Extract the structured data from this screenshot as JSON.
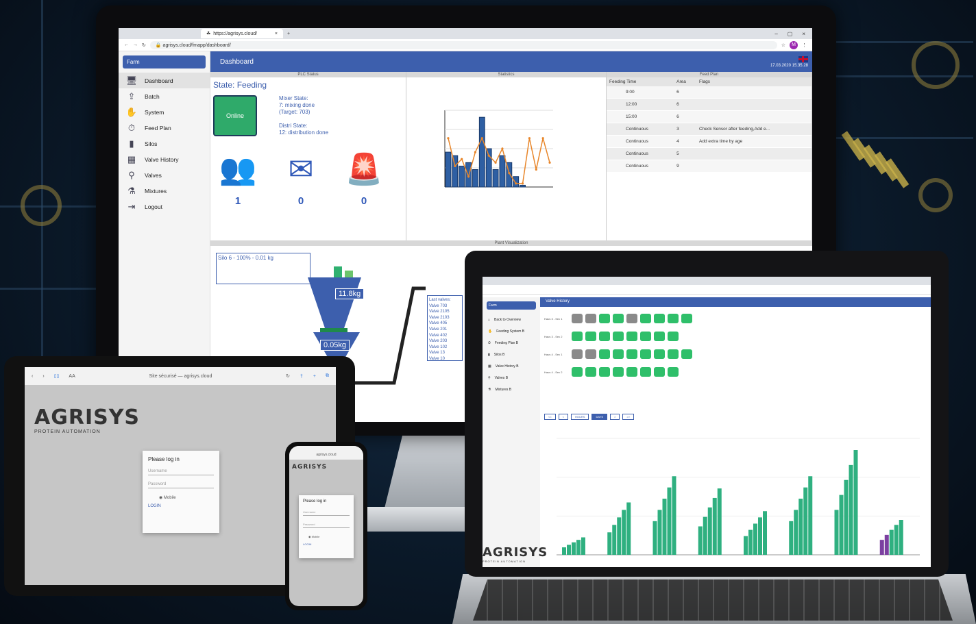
{
  "monitor": {
    "browser": {
      "tab_title": "https://agrisys.cloud/",
      "url": "agrisys.cloud/fmapp/dashboard/",
      "avatar_letter": "M"
    },
    "sidebar": {
      "farm_label": "Farm",
      "items": [
        {
          "label": "Dashboard",
          "icon": "monitor-icon"
        },
        {
          "label": "Batch",
          "icon": "batch-icon"
        },
        {
          "label": "System",
          "icon": "system-icon"
        },
        {
          "label": "Feed Plan",
          "icon": "feed-plan-icon"
        },
        {
          "label": "Silos",
          "icon": "silo-icon"
        },
        {
          "label": "Valve History",
          "icon": "valve-history-icon"
        },
        {
          "label": "Valves",
          "icon": "valve-icon"
        },
        {
          "label": "Mixtures",
          "icon": "mixture-icon"
        },
        {
          "label": "Logout",
          "icon": "logout-icon"
        }
      ]
    },
    "header": {
      "title": "Dashboard",
      "datetime": "17.03.2020 15.35.28"
    },
    "plc": {
      "panel_title": "PLC Status",
      "state": "State: Feeding",
      "online": "Online",
      "mixer_lines": [
        "Mixer State:",
        "7: mixing done",
        "(Target: 703)"
      ],
      "distri_lines": [
        "Distri State:",
        "12: distribution done"
      ],
      "counts": [
        {
          "icon": "users-icon",
          "value": "1"
        },
        {
          "icon": "mail-icon",
          "value": "0"
        },
        {
          "icon": "alarm-icon",
          "value": "0"
        }
      ]
    },
    "statistics": {
      "panel_title": "Statistics"
    },
    "feed_plan": {
      "panel_title": "Feed Plan",
      "columns": [
        "Feeding Time",
        "Area",
        "Flags"
      ],
      "rows": [
        [
          "9:00",
          "6",
          ""
        ],
        [
          "12:00",
          "6",
          ""
        ],
        [
          "15:00",
          "6",
          ""
        ],
        [
          "Continuous",
          "3",
          "Check Sensor after feeding,Add e..."
        ],
        [
          "Continuous",
          "4",
          "Add extra time by age"
        ],
        [
          "Continuous",
          "5",
          ""
        ],
        [
          "Continuous",
          "9",
          ""
        ]
      ]
    },
    "plant": {
      "panel_title": "Plant Visualization",
      "silo_label": "Silo 6 - 100% - 0.01 kg",
      "weight_top": "11.8kg",
      "weight_bottom": "0.05kg",
      "last_valves": [
        "Last valves:",
        "Valve 703",
        "Valve 2105",
        "Valve 2103",
        "Valve 405",
        "Valve 201",
        "Valve 402",
        "Valve 203",
        "Valve 102",
        "Valve 13",
        "Valve 10"
      ]
    }
  },
  "tablet": {
    "url": "Site sécurisé — agrisys.cloud",
    "logo": "AGRISYS",
    "logo_sub": "PROTEIN AUTOMATION",
    "login": {
      "title": "Please log in",
      "username": "Username",
      "password": "Password",
      "mobile": "Mobile",
      "button": "LOGIN"
    }
  },
  "phone": {
    "url": "agrisys.cloud",
    "login": {
      "title": "Please log in",
      "username": "Username",
      "password": "Password",
      "mobile": "Mobile",
      "button": "LOGIN"
    }
  },
  "laptop": {
    "header": {
      "title": "Valve History"
    },
    "sidebar": {
      "farm_label": "Farm",
      "items": [
        "Back to Overview",
        "Feeding System B",
        "Feeding Plan B",
        "Silos B",
        "Valve History B",
        "Valves B",
        "Mixtures B"
      ]
    },
    "valve_rows": [
      {
        "label": "Haus 3 - Sec 1",
        "states": [
          "off",
          "off",
          "on",
          "on",
          "off",
          "on",
          "on",
          "on",
          "on"
        ]
      },
      {
        "label": "Haus 3 - Sec 2",
        "states": [
          "on",
          "on",
          "on",
          "on",
          "on",
          "on",
          "on",
          "on"
        ]
      },
      {
        "label": "Haus 4 - Sec 1",
        "states": [
          "off",
          "off",
          "on",
          "on",
          "on",
          "on",
          "on",
          "on",
          "on"
        ]
      },
      {
        "label": "Haus 4 - Sec 2",
        "states": [
          "on",
          "on",
          "on",
          "on",
          "on",
          "on",
          "on",
          "on"
        ]
      }
    ],
    "time_buttons": [
      "<<",
      "<",
      "HOURS",
      "DAYS",
      ">",
      ">>"
    ],
    "logo": "AGRISYS",
    "logo_sub": "PROTEIN AUTOMATION"
  },
  "chart_data": [
    {
      "type": "bar",
      "categories": [
        "1",
        "2",
        "3",
        "4",
        "5",
        "6",
        "7",
        "8",
        "9",
        "10",
        "11",
        "12",
        "13",
        "14",
        "15",
        "16"
      ],
      "series": [
        {
          "values": [
            10,
            9,
            6,
            7,
            5,
            20,
            11,
            5,
            9,
            7,
            3,
            0.5,
            0,
            0,
            0,
            0
          ]
        },
        {
          "values": [
            14,
            6,
            8,
            3,
            10,
            14,
            9,
            7,
            11,
            4,
            1,
            1,
            14,
            5,
            14,
            7
          ]
        }
      ]
    },
    {
      "type": "bar",
      "categories": [
        "1",
        "2",
        "3",
        "4",
        "5",
        "6",
        "7",
        "8"
      ],
      "series": [
        {
          "values": [
            10,
            30,
            45,
            38,
            25,
            45,
            60,
            20
          ]
        }
      ]
    }
  ],
  "colors": {
    "brand_blue": "#3d5fad",
    "online_green": "#2faa6a",
    "bar_green": "#2fb080"
  }
}
